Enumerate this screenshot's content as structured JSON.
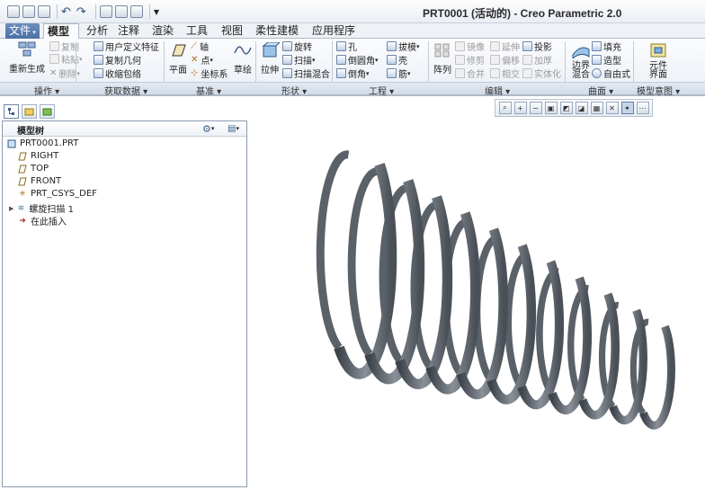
{
  "window": {
    "title": "PRT0001 (活动的) - Creo Parametric 2.0"
  },
  "quick_access": {
    "icons": [
      "new-icon",
      "open-icon",
      "save-icon",
      "undo-icon",
      "redo-icon",
      "regenerate-icon",
      "window-icon",
      "close-window-icon",
      "customize-icon"
    ]
  },
  "tabs": [
    "文件",
    "模型",
    "分析",
    "注释",
    "渲染",
    "工具",
    "视图",
    "柔性建模",
    "应用程序"
  ],
  "active_tab": "模型",
  "ribbon": {
    "operations": {
      "regenerate": "重新生成",
      "copy": "复制",
      "paste": "粘贴",
      "delete": "删除"
    },
    "get_data": {
      "udf": "用户定义特征",
      "copy_geom": "复制几何",
      "shrinkwrap": "收缩包络"
    },
    "datum": {
      "plane": "平面",
      "axis": "轴",
      "point": "点",
      "csys": "坐标系",
      "sketch": "草绘"
    },
    "shapes": {
      "extrude": "拉伸",
      "revolve": "旋转",
      "sweep": "扫描",
      "swept_blend": "扫描混合"
    },
    "engineering": {
      "hole": "孔",
      "draft": "拔模",
      "round": "倒圆角",
      "shell": "壳",
      "chamfer": "倒角",
      "rib": "筋"
    },
    "editing": {
      "pattern": "阵列",
      "mirror": "镜像",
      "extend": "延伸",
      "project": "投影",
      "trim": "修剪",
      "offset": "偏移",
      "thicken": "加厚",
      "merge": "合并",
      "intersect": "相交",
      "solidify": "实体化"
    },
    "surfaces": {
      "boundary_blend": "边界混合",
      "fill": "填充",
      "style": "造型",
      "freestyle": "自由式"
    },
    "model_intent": {
      "component_interface": "元件界面"
    }
  },
  "groups": [
    "操作",
    "获取数据",
    "基准",
    "形状",
    "工程",
    "编辑",
    "曲面",
    "模型意图"
  ],
  "model_tree": {
    "title": "模型树",
    "nodes": [
      {
        "label": "PRT0001.PRT",
        "icon": "part-icon"
      },
      {
        "label": "RIGHT",
        "icon": "datum-plane-icon"
      },
      {
        "label": "TOP",
        "icon": "datum-plane-icon"
      },
      {
        "label": "FRONT",
        "icon": "datum-plane-icon"
      },
      {
        "label": "PRT_CSYS_DEF",
        "icon": "csys-icon"
      },
      {
        "label": "螺旋扫描 1",
        "icon": "helical-sweep-icon"
      },
      {
        "label": "在此插入",
        "icon": "insert-here-icon"
      }
    ]
  },
  "view_toolbar": {
    "icons": [
      "refit-icon",
      "zoom-in-icon",
      "zoom-out-icon",
      "repaint-icon",
      "view-orientation-icon",
      "saved-views-icon",
      "display-style-icon",
      "datum-display-icon",
      "spin-center-icon",
      "annotation-display-icon"
    ]
  },
  "colors": {
    "accent": "#4a6fa5",
    "spring": "#555b62"
  }
}
